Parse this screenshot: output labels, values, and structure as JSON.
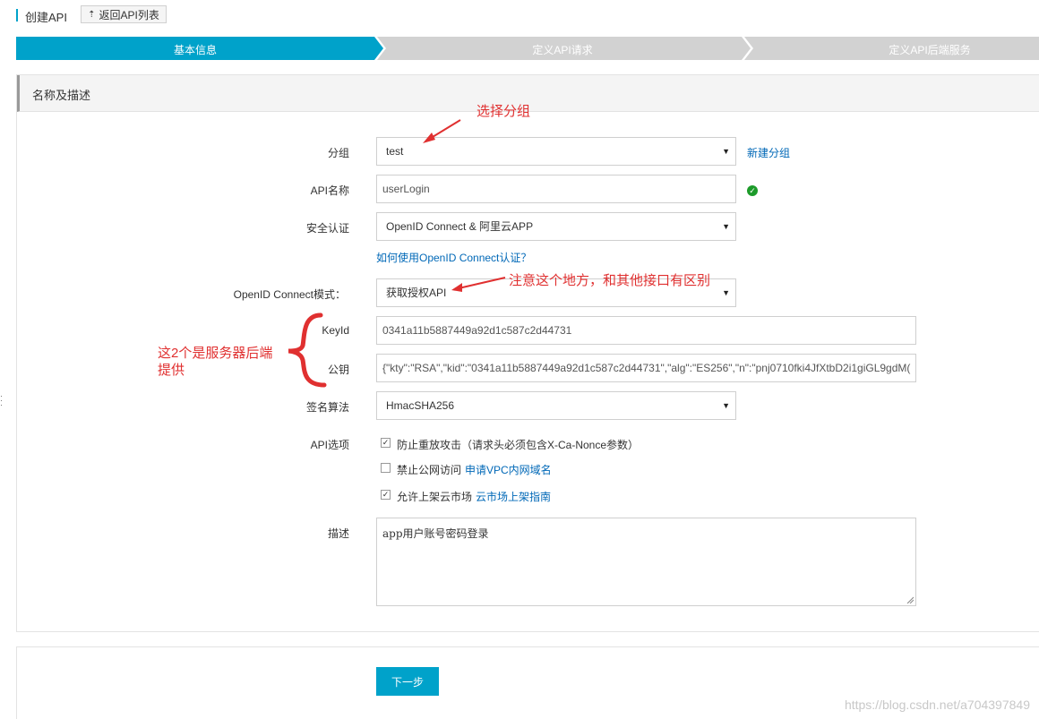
{
  "header": {
    "title": "创建API",
    "back_label": "返回API列表"
  },
  "steps": [
    {
      "label": "基本信息",
      "active": true
    },
    {
      "label": "定义API请求",
      "active": false
    },
    {
      "label": "定义API后端服务",
      "active": false
    }
  ],
  "panel": {
    "title": "名称及描述"
  },
  "form": {
    "group": {
      "label": "分组",
      "value": "test",
      "link": "新建分组"
    },
    "api_name": {
      "label": "API名称",
      "value": "userLogin"
    },
    "auth": {
      "label": "安全认证",
      "value": "OpenID Connect & 阿里云APP",
      "help_link": "如何使用OpenID Connect认证？"
    },
    "oidc_mode": {
      "label": "OpenID Connect模式：",
      "value": "获取授权API"
    },
    "key_id": {
      "label": "KeyId",
      "value": "0341a11b5887449a92d1c587c2d44731"
    },
    "public_key": {
      "label": "公钥",
      "value": "{\"kty\":\"RSA\",\"kid\":\"0341a11b5887449a92d1c587c2d44731\",\"alg\":\"ES256\",\"n\":\"pnj0710fki4JfXtbD2i1giGL9gdM("
    },
    "sign_algo": {
      "label": "签名算法",
      "value": "HmacSHA256"
    },
    "api_options": {
      "label": "API选项",
      "items": [
        {
          "label": "防止重放攻击（请求头必须包含X-Ca-Nonce参数）",
          "checked": true,
          "link": ""
        },
        {
          "label": "禁止公网访问",
          "checked": false,
          "link": "申请VPC内网域名"
        },
        {
          "label": "允许上架云市场",
          "checked": true,
          "link": "云市场上架指南"
        }
      ]
    },
    "description": {
      "label": "描述",
      "value": "app用户账号密码登录"
    }
  },
  "next_button": "下一步",
  "annotations": {
    "select_group": "选择分组",
    "note_diff": "注意这个地方，和其他接口有区别",
    "server_provided_1": "这2个是服务器后端",
    "server_provided_2": "提供"
  },
  "watermark": "https://blog.csdn.net/a704397849",
  "colors": {
    "accent": "#00a2ca",
    "step_inactive": "#d2d2d2",
    "link": "#0068b7",
    "annotation_red": "#e03030",
    "success_green": "#1d9b2a"
  },
  "icons": {
    "back": "upload-arrow-icon",
    "caret": "caret-down-icon",
    "valid": "check-circle-icon"
  }
}
